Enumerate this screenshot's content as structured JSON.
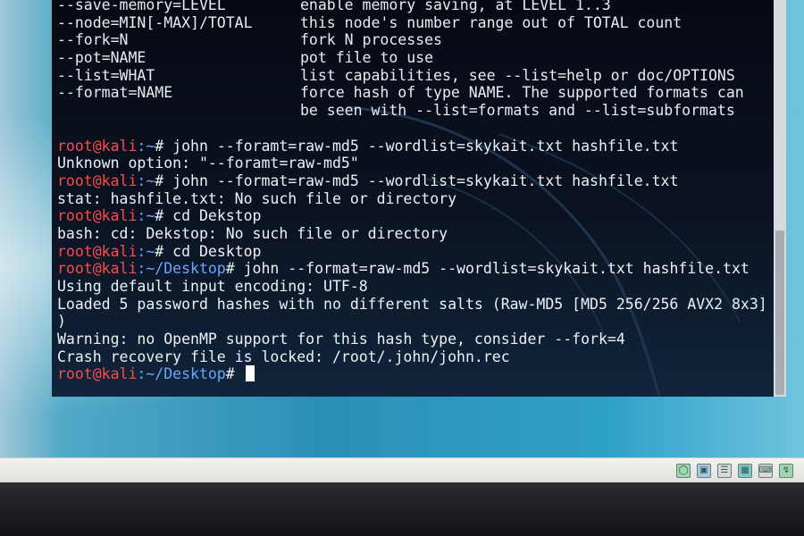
{
  "terminal": {
    "help_lines": [
      {
        "option": "--save-memory=LEVEL",
        "desc": "enable memory saving, at LEVEL 1..3"
      },
      {
        "option": "--node=MIN[-MAX]/TOTAL",
        "desc": "this node's number range out of TOTAL count"
      },
      {
        "option": "--fork=N",
        "desc": "fork N processes"
      },
      {
        "option": "--pot=NAME",
        "desc": "pot file to use"
      },
      {
        "option": "--list=WHAT",
        "desc": "list capabilities, see --list=help or doc/OPTIONS"
      },
      {
        "option": "--format=NAME",
        "desc": "force hash of type NAME. The supported formats can"
      },
      {
        "option": "",
        "desc": "be seen with --list=formats and --list=subformats"
      }
    ],
    "prompt_user": "root@kali",
    "prompt_home_path": ":~",
    "prompt_home_sign": "# ",
    "prompt_desktop_path": ":~/Desktop",
    "prompt_desktop_sign": "# ",
    "cmd_1": "john --foramt=raw-md5 --wordlist=skykait.txt hashfile.txt",
    "out_1": "Unknown option: \"--foramt=raw-md5\"",
    "cmd_2": "john --format=raw-md5 --wordlist=skykait.txt hashfile.txt",
    "out_2": "stat: hashfile.txt: No such file or directory",
    "cmd_3": "cd Dekstop",
    "out_3": "bash: cd: Dekstop: No such file or directory",
    "cmd_4": "cd Desktop",
    "cmd_5": "john --format=raw-md5 --wordlist=skykait.txt hashfile.txt",
    "out_5a": "Using default input encoding: UTF-8",
    "out_5b": "Loaded 5 password hashes with no different salts (Raw-MD5 [MD5 256/256 AVX2 8x3]",
    "out_5c": ")",
    "out_5d": "Warning: no OpenMP support for this hash type, consider --fork=4",
    "out_5e": "Crash recovery file is locked: /root/.john/john.rec"
  },
  "colors": {
    "prompt_user": "#ff4a4a",
    "prompt_path": "#6aa6ff",
    "terminal_text": "#eef1f5",
    "terminal_bg": "#0b1322",
    "desktop_bg": "#2b8fb6"
  },
  "taskbar": {
    "tray_icons": [
      "network-icon",
      "display-icon",
      "storage-icon",
      "folder-icon",
      "keyboard-icon",
      "usb-icon"
    ]
  }
}
